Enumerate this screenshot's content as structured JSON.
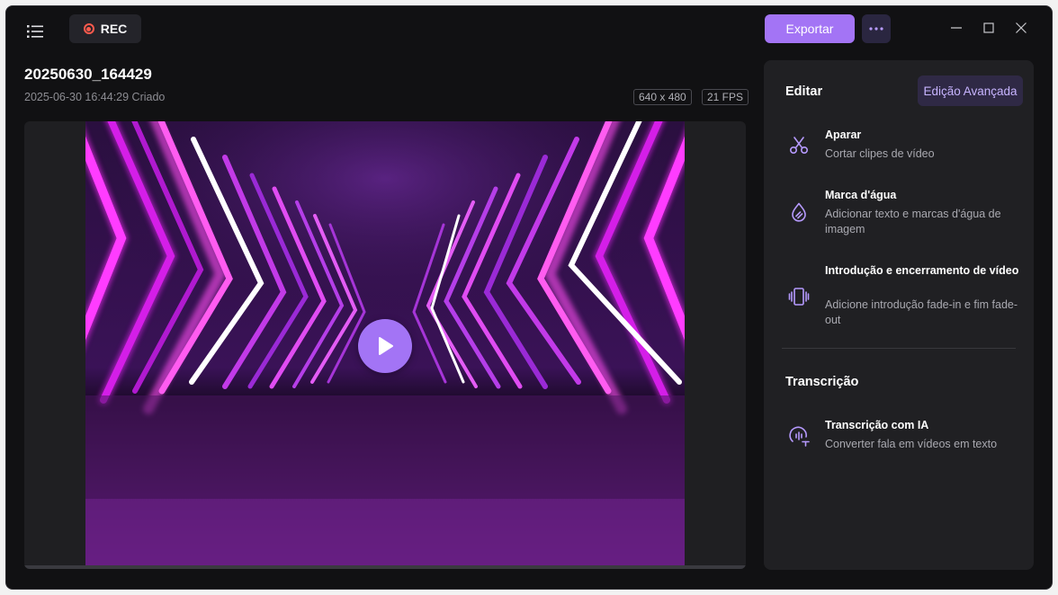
{
  "topbar": {
    "rec_label": "REC",
    "export_label": "Exportar"
  },
  "file": {
    "title": "20250630_164429",
    "created": "2025-06-30 16:44:29 Criado",
    "resolution": "640 x 480",
    "fps": "21 FPS"
  },
  "panel": {
    "edit_heading": "Editar",
    "advanced_label": "Edição Avançada",
    "tools": [
      {
        "title": "Aparar",
        "desc": "Cortar clipes de vídeo",
        "icon": "scissors-icon"
      },
      {
        "title": "Marca d'água",
        "desc": "Adicionar texto e marcas d'água de imagem",
        "icon": "watermark-drop-icon"
      },
      {
        "title": "Introdução e encerramento de vídeo",
        "desc": "Adicione introdução fade-in e fim fade-out",
        "icon": "intro-outro-icon"
      }
    ],
    "transcription_heading": "Transcrição",
    "transcription_tool": {
      "title": "Transcrição com IA",
      "desc": "Converter fala em vídeos em texto",
      "icon": "ai-transcription-icon"
    }
  },
  "colors": {
    "accent": "#a374f5",
    "rec_red": "#ff5a4d",
    "background": "#111113",
    "panel": "#202023"
  }
}
